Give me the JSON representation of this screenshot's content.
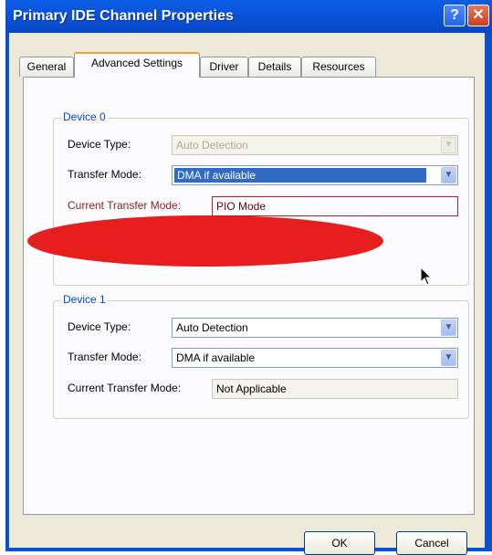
{
  "window": {
    "title": "Primary IDE Channel Properties",
    "help_label": "?",
    "close_label": "✕"
  },
  "tabs": [
    {
      "label": "General",
      "active": false
    },
    {
      "label": "Advanced Settings",
      "active": true
    },
    {
      "label": "Driver",
      "active": false
    },
    {
      "label": "Details",
      "active": false
    },
    {
      "label": "Resources",
      "active": false
    }
  ],
  "device0": {
    "group_label": "Device 0",
    "device_type_label": "Device Type:",
    "device_type_value": "Auto Detection",
    "transfer_mode_label": "Transfer Mode:",
    "transfer_mode_value": "DMA if available",
    "current_mode_label": "Current Transfer Mode:",
    "current_mode_value": "PIO Mode"
  },
  "device1": {
    "group_label": "Device 1",
    "device_type_label": "Device Type:",
    "device_type_value": "Auto Detection",
    "transfer_mode_label": "Transfer Mode:",
    "transfer_mode_value": "DMA if available",
    "current_mode_label": "Current Transfer Mode:",
    "current_mode_value": "Not Applicable"
  },
  "buttons": {
    "ok": "OK",
    "cancel": "Cancel"
  },
  "icons": {
    "dropdown": "chevron-down-icon",
    "cursor": "mouse-pointer-icon"
  },
  "colors": {
    "titlebar": "#0a52cf",
    "dialog_bg": "#ece9d8",
    "highlight": "#e50d0d",
    "selection": "#316ac5",
    "group_label": "#0046d5"
  }
}
